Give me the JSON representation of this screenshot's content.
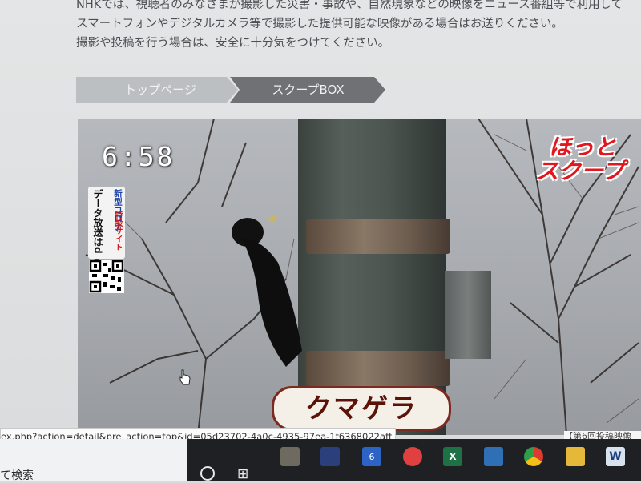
{
  "intro": {
    "line1": "NHKでは、視聴者のみなさまが撮影した災害・事故や、自然現象などの映像をニュース番組等で利用して",
    "line2": "スマートフォンやデジタルカメラ等で撮影した提供可能な映像がある場合はお送りください。",
    "line3": "撮影や投稿を行う場合は、安全に十分気をつけてください。"
  },
  "breadcrumb": {
    "top": "トップページ",
    "current": "スクープBOX"
  },
  "video": {
    "clock": "6:58",
    "logo_line1": "ほっと",
    "logo_line2": "スクープ",
    "data_broadcast": "データ放送はd",
    "corona": "新型コロナ",
    "site": "特設サイト",
    "caption": "クマゲラ"
  },
  "status_url": "ex.php?action=detail&pre_action=top&id=05d23702-4a0c-4935-97ea-1f6368022aff",
  "right_text": "【第6回投稿映像",
  "taskbar": {
    "search_text": "て検索",
    "calendar_day": "6",
    "icons": [
      "folder-camera-icon",
      "app-icon",
      "calendar-icon",
      "paint-icon",
      "excel-icon",
      "hotspot-icon",
      "chrome-icon",
      "file-explorer-icon",
      "word-icon"
    ]
  }
}
